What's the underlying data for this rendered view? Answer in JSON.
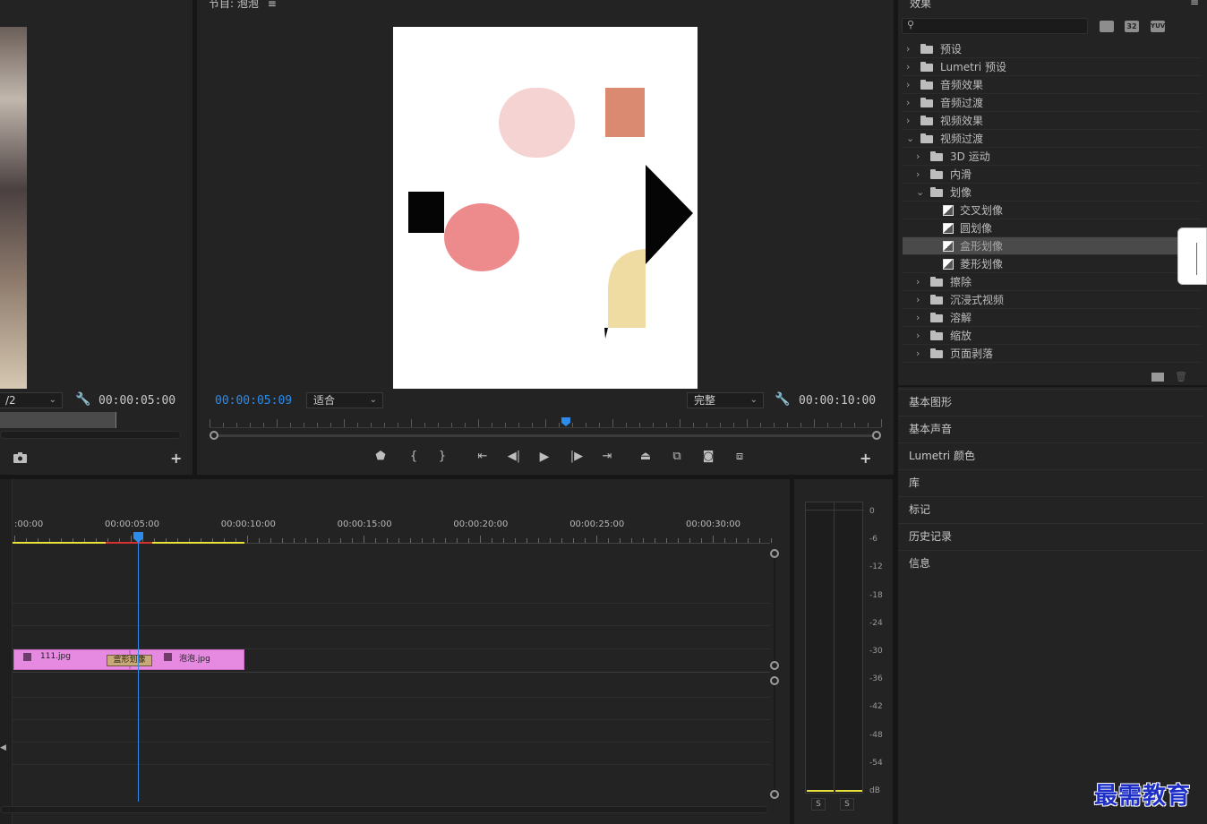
{
  "source_monitor": {
    "scale_value": "/2",
    "duration": "00:00:05:00"
  },
  "program_monitor": {
    "title": "节目: 泡泡",
    "current_time": "00:00:05:09",
    "fit_value": "适合",
    "quality_value": "完整",
    "duration": "00:00:10:00",
    "playhead_position": 0.53
  },
  "effects_panel": {
    "title": "效果",
    "search_placeholder": "",
    "filter_badges": [
      "32",
      "YUV"
    ],
    "tree": [
      {
        "label": "预设",
        "level": 0,
        "expanded": false,
        "kind": "preset-folder"
      },
      {
        "label": "Lumetri 预设",
        "level": 0,
        "expanded": false,
        "kind": "preset-folder"
      },
      {
        "label": "音频效果",
        "level": 0,
        "expanded": false,
        "kind": "folder"
      },
      {
        "label": "音频过渡",
        "level": 0,
        "expanded": false,
        "kind": "folder"
      },
      {
        "label": "视频效果",
        "level": 0,
        "expanded": false,
        "kind": "folder"
      },
      {
        "label": "视频过渡",
        "level": 0,
        "expanded": true,
        "kind": "folder"
      },
      {
        "label": "3D 运动",
        "level": 1,
        "expanded": false,
        "kind": "folder"
      },
      {
        "label": "内滑",
        "level": 1,
        "expanded": false,
        "kind": "folder"
      },
      {
        "label": "划像",
        "level": 1,
        "expanded": true,
        "kind": "folder"
      },
      {
        "label": "交叉划像",
        "level": 2,
        "kind": "transition"
      },
      {
        "label": "圆划像",
        "level": 2,
        "kind": "transition"
      },
      {
        "label": "盒形划像",
        "level": 2,
        "kind": "transition",
        "selected": true
      },
      {
        "label": "菱形划像",
        "level": 2,
        "kind": "transition"
      },
      {
        "label": "擦除",
        "level": 1,
        "expanded": false,
        "kind": "folder"
      },
      {
        "label": "沉浸式视频",
        "level": 1,
        "expanded": false,
        "kind": "folder"
      },
      {
        "label": "溶解",
        "level": 1,
        "expanded": false,
        "kind": "folder"
      },
      {
        "label": "缩放",
        "level": 1,
        "expanded": false,
        "kind": "folder"
      },
      {
        "label": "页面剥落",
        "level": 1,
        "expanded": false,
        "kind": "folder"
      }
    ]
  },
  "side_sections": [
    "基本图形",
    "基本声音",
    "Lumetri 颜色",
    "库",
    "标记",
    "历史记录",
    "信息"
  ],
  "timeline": {
    "ruler_labels": [
      ":00:00",
      "00:00:05:00",
      "00:00:10:00",
      "00:00:15:00",
      "00:00:20:00",
      "00:00:25:00",
      "00:00:30:00"
    ],
    "clips": [
      {
        "name": "111.jpg"
      },
      {
        "name": "泡泡.jpg"
      }
    ],
    "transition_label": "盒形划像"
  },
  "audio_meter": {
    "scale": [
      "0",
      "-6",
      "-12",
      "-18",
      "-24",
      "-30",
      "-36",
      "-42",
      "-48",
      "-54",
      "dB"
    ],
    "solo_buttons": [
      "S",
      "S"
    ]
  },
  "watermark": "最需教育",
  "colors": {
    "accent_blue": "#2d8ceb",
    "clip_pink": "#e58ae0",
    "transition_tan": "#c7a97a",
    "work_area_yellow": "#e8e23a",
    "render_red": "#d93030"
  }
}
